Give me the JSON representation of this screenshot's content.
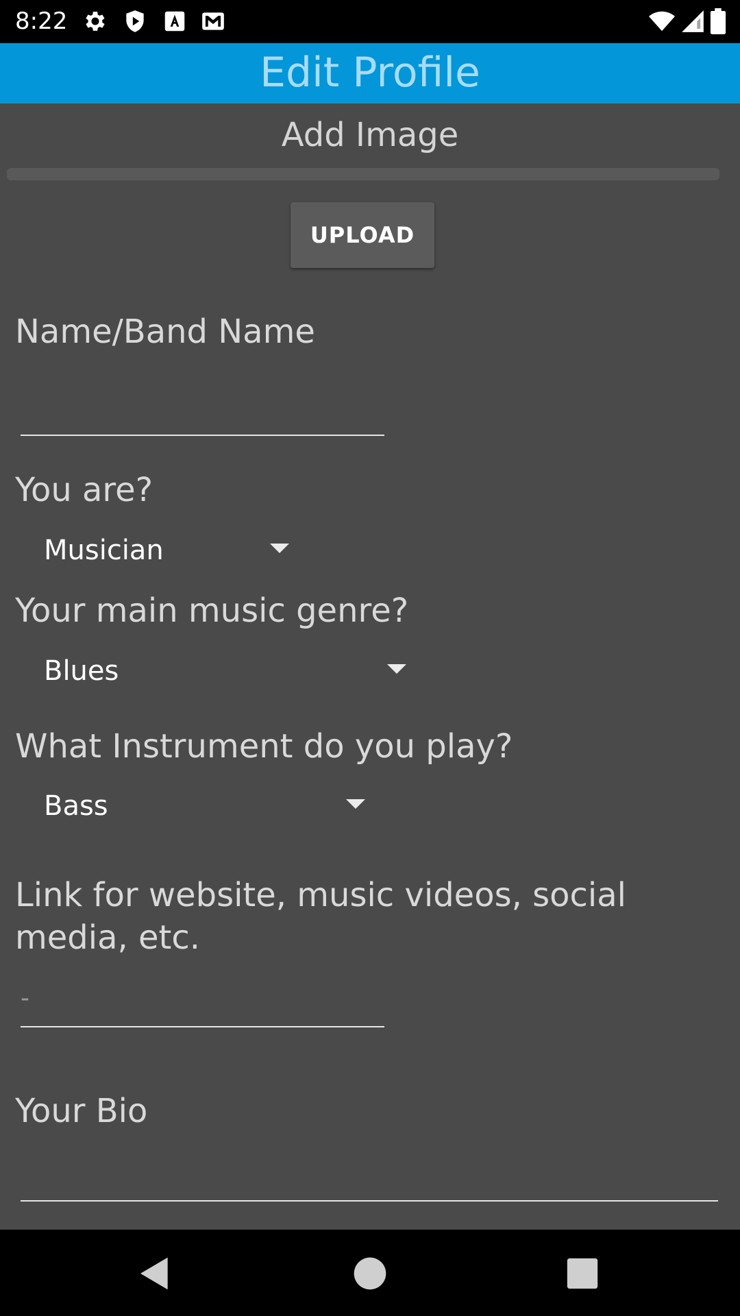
{
  "status_bar": {
    "time": "8:22",
    "icons": [
      "gear-icon",
      "shield-play-icon",
      "font-a-icon",
      "gmail-icon",
      "wifi-icon",
      "cell-signal-icon",
      "battery-icon"
    ]
  },
  "app_bar": {
    "title": "Edit Profile"
  },
  "profile_form": {
    "add_image_label": "Add Image",
    "upload_label": "UPLOAD",
    "name_label": "Name/Band Name",
    "name_value": "",
    "you_are_label": "You are?",
    "you_are_value": "Musician",
    "genre_label": "Your main music genre?",
    "genre_value": "Blues",
    "instrument_label": "What Instrument do you play?",
    "instrument_value": "Bass",
    "link_label": "Link for website, music videos, social media, etc.",
    "link_placeholder": "-",
    "link_value": "",
    "bio_label": "Your Bio",
    "bio_value": ""
  },
  "nav_bar": {
    "icons": [
      "back-icon",
      "home-icon",
      "recents-icon"
    ]
  },
  "colors": {
    "app_bar": "#0396d8",
    "app_title": "#a6dcf5",
    "background": "#4a4a4a",
    "button": "#5b5b5b"
  }
}
